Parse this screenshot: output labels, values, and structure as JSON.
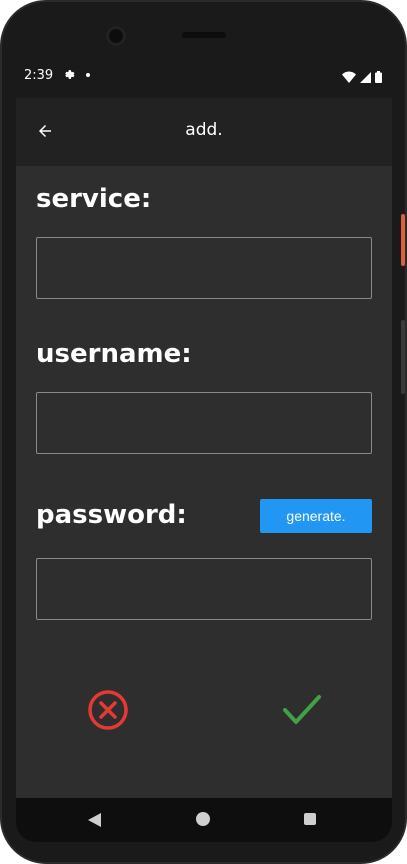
{
  "status_bar": {
    "time": "2:39",
    "icons": [
      "settings-icon",
      "notification-dot-icon",
      "wifi-icon",
      "signal-icon",
      "battery-icon"
    ]
  },
  "app_bar": {
    "title": "add.",
    "back_icon": "arrow-back-icon"
  },
  "form": {
    "service": {
      "label": "service:",
      "value": "",
      "placeholder": ""
    },
    "username": {
      "label": "username:",
      "value": "",
      "placeholder": ""
    },
    "password": {
      "label": "password:",
      "value": "",
      "placeholder": ""
    },
    "generate_label": "generate."
  },
  "actions": {
    "cancel_icon": "cancel-circle-icon",
    "confirm_icon": "checkmark-icon"
  },
  "navigation_bar": {
    "icons": [
      "nav-back-icon",
      "nav-home-icon",
      "nav-recents-icon"
    ]
  },
  "colors": {
    "background": "#2e2e2e",
    "app_bar": "#222222",
    "accent": "#2196f3",
    "cancel": "#e53935",
    "confirm": "#43a047"
  }
}
